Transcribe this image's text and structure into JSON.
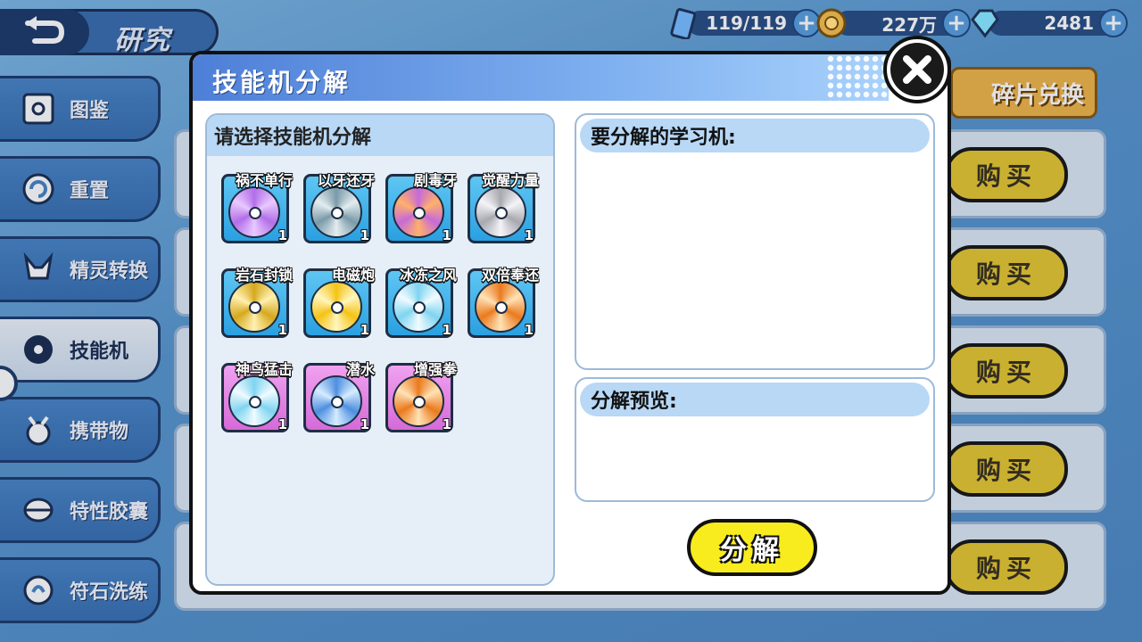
{
  "header": {
    "title": "研究"
  },
  "resources": [
    {
      "icon": "energy-battery-icon",
      "value": "119/119"
    },
    {
      "icon": "coin-icon",
      "value": "227万"
    },
    {
      "icon": "diamond-icon",
      "value": "2481"
    }
  ],
  "sidebar": {
    "items": [
      {
        "label": "图鉴",
        "icon": "pokedex-icon"
      },
      {
        "label": "重置",
        "icon": "reset-icon"
      },
      {
        "label": "精灵转换",
        "icon": "convert-icon"
      },
      {
        "label": "技能机",
        "icon": "disc-icon",
        "active": true
      },
      {
        "label": "携带物",
        "icon": "held-item-icon"
      },
      {
        "label": "特性胶囊",
        "icon": "capsule-icon"
      },
      {
        "label": "符石洗练",
        "icon": "rune-icon"
      }
    ]
  },
  "shop": {
    "fragment_exchange": "碎片兑换",
    "buy_label": "购买",
    "rows": 5
  },
  "modal": {
    "title": "技能机分解",
    "select_header": "请选择技能机分解",
    "to_split_header": "要分解的学习机:",
    "preview_header": "分解预览:",
    "split_button": "分解",
    "items": [
      {
        "name": "祸不单行",
        "count": "1",
        "frame": "blue",
        "disc": "purple"
      },
      {
        "name": "以牙还牙",
        "count": "1",
        "frame": "blue",
        "disc": "gray"
      },
      {
        "name": "剧毒牙",
        "count": "1",
        "frame": "blue",
        "disc": "magenta"
      },
      {
        "name": "觉醒力量",
        "count": "1",
        "frame": "blue",
        "disc": "silver"
      },
      {
        "name": "岩石封锁",
        "count": "1",
        "frame": "blue",
        "disc": "gold"
      },
      {
        "name": "电磁炮",
        "count": "1",
        "frame": "blue",
        "disc": "yellow"
      },
      {
        "name": "冰冻之风",
        "count": "1",
        "frame": "blue",
        "disc": "ice"
      },
      {
        "name": "双倍奉还",
        "count": "1",
        "frame": "blue",
        "disc": "orange"
      },
      {
        "name": "神鸟猛击",
        "count": "1",
        "frame": "pink",
        "disc": "ice"
      },
      {
        "name": "潜水",
        "count": "1",
        "frame": "pink",
        "disc": "blue"
      },
      {
        "name": "增强拳",
        "count": "1",
        "frame": "pink",
        "disc": "orange"
      }
    ]
  },
  "colors": {
    "purple": [
      "#b26ee8",
      "#e9c9ff"
    ],
    "gray": [
      "#7a9aa8",
      "#e3ecef"
    ],
    "magenta": [
      "#c76ad8",
      "#ffb06a"
    ],
    "silver": [
      "#a8a8b0",
      "#f4f4f8"
    ],
    "gold": [
      "#d6a81e",
      "#fff0b0"
    ],
    "yellow": [
      "#f4c316",
      "#fff6bf"
    ],
    "ice": [
      "#7fd4f0",
      "#f0fbff"
    ],
    "orange": [
      "#ea7a1e",
      "#ffe2b6"
    ],
    "blue": [
      "#4e8fe0",
      "#d6ecff"
    ]
  }
}
